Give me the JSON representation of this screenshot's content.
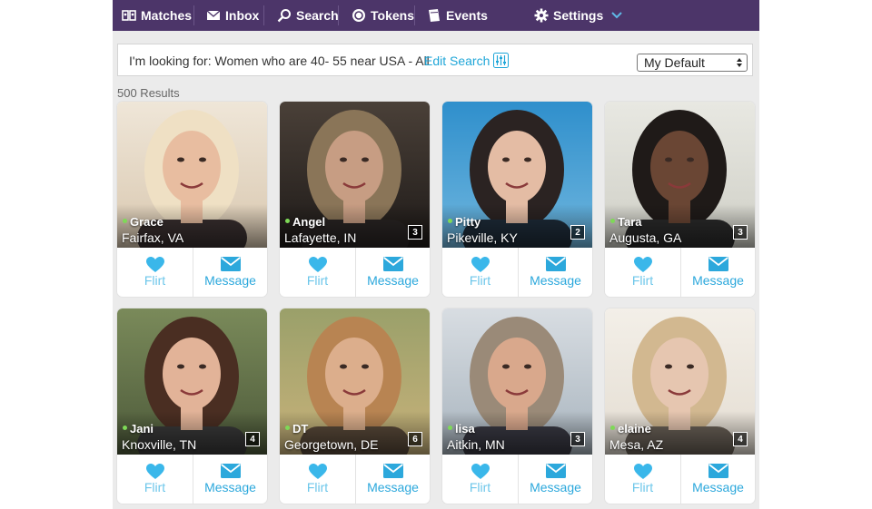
{
  "nav": {
    "matches": "Matches",
    "inbox": "Inbox",
    "search": "Search",
    "tokens": "Tokens",
    "events": "Events",
    "settings": "Settings"
  },
  "search": {
    "looking_for": "I'm looking for: Women who are 40- 55 near USA - All",
    "edit_search": "Edit Search",
    "sort_value": "My Default"
  },
  "results_count": "500 Results",
  "actions": {
    "flirt": "Flirt",
    "message": "Message"
  },
  "colors": {
    "nav_bg": "#4c3569",
    "accent": "#1fa6d8",
    "online": "#7ed957"
  },
  "profiles": [
    {
      "name": "Grace",
      "location": "Fairfax, VA",
      "photos": ""
    },
    {
      "name": "Angel",
      "location": "Lafayette, IN",
      "photos": "3"
    },
    {
      "name": "Pitty",
      "location": "Pikeville, KY",
      "photos": "2"
    },
    {
      "name": "Tara",
      "location": "Augusta, GA",
      "photos": "3"
    },
    {
      "name": "Jani",
      "location": "Knoxville, TN",
      "photos": "4"
    },
    {
      "name": "DT",
      "location": "Georgetown, DE",
      "photos": "6"
    },
    {
      "name": "lisa",
      "location": "Aitkin, MN",
      "photos": "3"
    },
    {
      "name": "elaine",
      "location": "Mesa, AZ",
      "photos": "4"
    }
  ]
}
